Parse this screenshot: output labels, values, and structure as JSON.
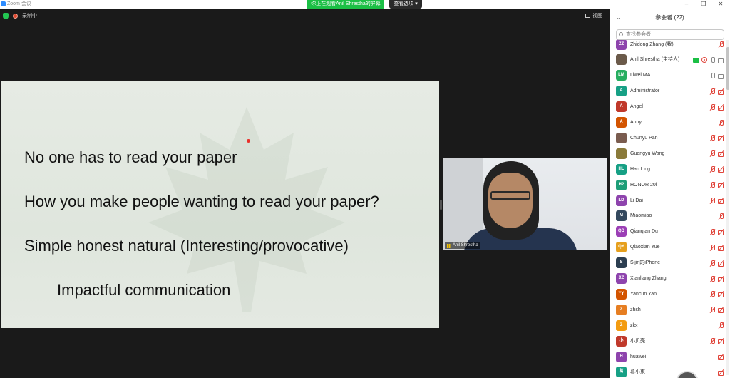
{
  "window": {
    "title": "Zoom 会议"
  },
  "banner": {
    "sharing_text": "你正在观看Anil Shrestha的屏幕",
    "view_options": "查看选项"
  },
  "meeting": {
    "recording_label": "录制中",
    "view_label": "视图"
  },
  "slide": {
    "lines": [
      "No one has to read your paper",
      "How you make people wanting to read your paper?",
      "Simple honest natural (Interesting/provocative)",
      "Impactful communication"
    ]
  },
  "video": {
    "name": "Anil Shrestha"
  },
  "panel": {
    "title": "参会者 (22)",
    "search_placeholder": "查找参会者",
    "participants": [
      {
        "initials": "ZZ",
        "name": "Zhidong Zhang (我)",
        "color": "#8e44ad",
        "icons": [
          "mic-off"
        ]
      },
      {
        "initials": "",
        "name": "Anil Shrestha (主持人)",
        "color": "#6b5a4a",
        "photo": true,
        "icons": [
          "share",
          "rec",
          "mic-on",
          "cam-on"
        ]
      },
      {
        "initials": "LM",
        "name": "Liwei MA",
        "color": "#27ae60",
        "icons": [
          "mic-on",
          "cam-on"
        ]
      },
      {
        "initials": "A",
        "name": "Administrator",
        "color": "#16a085",
        "icons": [
          "mic-off",
          "cam-off"
        ]
      },
      {
        "initials": "A",
        "name": "Angel",
        "color": "#c0392b",
        "icons": [
          "mic-off",
          "cam-off"
        ]
      },
      {
        "initials": "A",
        "name": "Anny",
        "color": "#d35400",
        "icons": [
          "mic-off"
        ]
      },
      {
        "initials": "",
        "name": "Chunyu Pan",
        "color": "#7a5c4f",
        "photo": true,
        "icons": [
          "mic-off",
          "cam-off"
        ]
      },
      {
        "initials": "",
        "name": "Guangyu Wang",
        "color": "#8a7a3a",
        "photo": true,
        "icons": [
          "mic-off",
          "cam-off"
        ]
      },
      {
        "initials": "HL",
        "name": "Han Ling",
        "color": "#16a085",
        "icons": [
          "mic-off",
          "cam-off"
        ]
      },
      {
        "initials": "H2",
        "name": "HONOR 20i",
        "color": "#1e9e78",
        "icons": [
          "mic-off",
          "cam-off"
        ]
      },
      {
        "initials": "LD",
        "name": "Li Dai",
        "color": "#8e44ad",
        "icons": [
          "mic-off",
          "cam-off"
        ]
      },
      {
        "initials": "M",
        "name": "Miaomiao",
        "color": "#34495e",
        "icons": [
          "mic-off"
        ]
      },
      {
        "initials": "QD",
        "name": "Qianqian Du",
        "color": "#9b3fb5",
        "icons": [
          "mic-off",
          "cam-off"
        ]
      },
      {
        "initials": "QY",
        "name": "Qiaoxian Yue",
        "color": "#e6a01e",
        "icons": [
          "mic-off",
          "cam-off"
        ]
      },
      {
        "initials": "S",
        "name": "Sijin的iPhone",
        "color": "#2c3e50",
        "icons": [
          "mic-off",
          "cam-off"
        ]
      },
      {
        "initials": "XZ",
        "name": "Xianliang Zhang",
        "color": "#8e44ad",
        "icons": [
          "mic-off",
          "cam-off"
        ]
      },
      {
        "initials": "YY",
        "name": "Yancun Yan",
        "color": "#d35400",
        "icons": [
          "mic-off",
          "cam-off"
        ]
      },
      {
        "initials": "Z",
        "name": "zhsh",
        "color": "#e67e22",
        "icons": [
          "mic-off",
          "cam-off"
        ]
      },
      {
        "initials": "Z",
        "name": "zkx",
        "color": "#f39c12",
        "icons": [
          "mic-off"
        ]
      },
      {
        "initials": "小",
        "name": "小贝壳",
        "color": "#c0392b",
        "icons": [
          "mic-off",
          "cam-off"
        ]
      },
      {
        "initials": "H",
        "name": "huawei",
        "color": "#8e44ad",
        "icons": [
          "cam-off"
        ]
      },
      {
        "initials": "葛",
        "name": "葛小東",
        "color": "#16a085",
        "icons": [
          "cam-off"
        ]
      }
    ]
  }
}
